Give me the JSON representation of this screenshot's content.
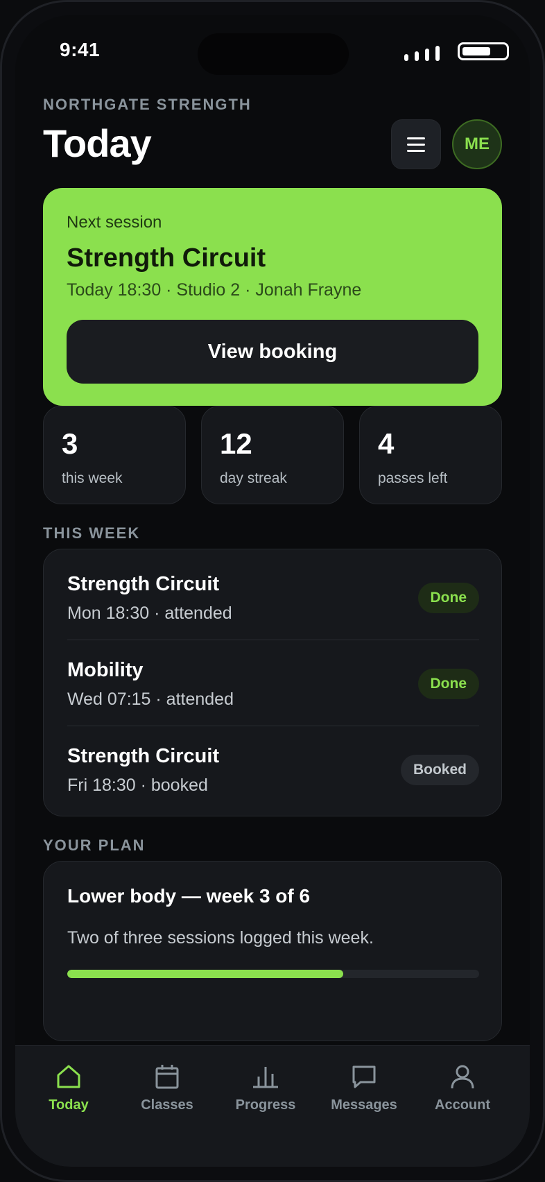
{
  "status_bar": {
    "time": "9:41"
  },
  "header": {
    "gym_name": "NORTHGATE STRENGTH",
    "title": "Today",
    "avatar_initials": "ME"
  },
  "next_session": {
    "label": "Next session",
    "title": "Strength Circuit",
    "meta": "Today 18:30 · Studio 2 · Jonah Frayne",
    "button_label": "View booking"
  },
  "stats": [
    {
      "value": "3",
      "label": "this week"
    },
    {
      "value": "12",
      "label": "day streak"
    },
    {
      "value": "4",
      "label": "passes left"
    }
  ],
  "this_week": {
    "title": "THIS WEEK",
    "items": [
      {
        "name": "Strength Circuit",
        "sub": "Mon 18:30 · attended",
        "badge": "Done",
        "status": "done"
      },
      {
        "name": "Mobility",
        "sub": "Wed 07:15 · attended",
        "badge": "Done",
        "status": "done"
      },
      {
        "name": "Strength Circuit",
        "sub": "Fri 18:30 · booked",
        "badge": "Booked",
        "status": "booked"
      }
    ]
  },
  "plan": {
    "section_title": "YOUR PLAN",
    "title": "Lower body — week 3 of 6",
    "desc": "Two of three sessions logged this week.",
    "progress": 0.67
  },
  "tabs": [
    {
      "label": "Today",
      "icon": "home-icon",
      "active": true
    },
    {
      "label": "Classes",
      "icon": "calendar-icon",
      "active": false
    },
    {
      "label": "Progress",
      "icon": "bar-chart-icon",
      "active": false
    },
    {
      "label": "Messages",
      "icon": "message-icon",
      "active": false
    },
    {
      "label": "Account",
      "icon": "user-icon",
      "active": false
    }
  ],
  "colors": {
    "accent": "#8be04e",
    "background": "#0a0b0d",
    "card": "#16181c"
  }
}
